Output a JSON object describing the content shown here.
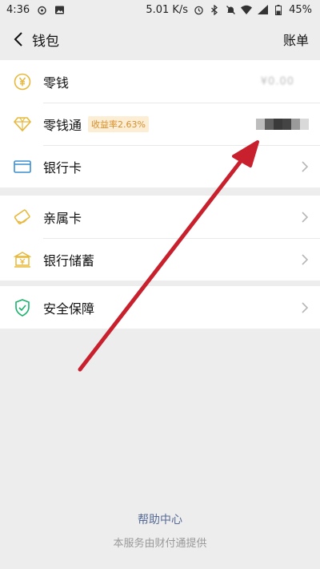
{
  "status_bar": {
    "time": "4:36",
    "network_speed": "5.01 K/s",
    "battery": "45%",
    "icons": [
      "weibo-icon",
      "gallery-icon",
      "alarm-icon",
      "bluetooth-icon",
      "mute-icon",
      "wifi-icon",
      "signal-icon",
      "battery-icon"
    ]
  },
  "nav": {
    "title": "钱包",
    "right_label": "账单"
  },
  "groups": [
    {
      "items": [
        {
          "label": "零钱",
          "icon": "yuan-coin-icon",
          "value_hidden": "¥0.00"
        },
        {
          "label": "零钱通",
          "icon": "diamond-icon",
          "badge": "收益率2.63%"
        },
        {
          "label": "银行卡",
          "icon": "bank-card-icon"
        }
      ]
    },
    {
      "items": [
        {
          "label": "亲属卡",
          "icon": "family-card-icon"
        },
        {
          "label": "银行储蓄",
          "icon": "bank-savings-icon"
        }
      ]
    },
    {
      "items": [
        {
          "label": "安全保障",
          "icon": "shield-icon"
        }
      ]
    }
  ],
  "footer": {
    "help_link": "帮助中心",
    "provider_text": "本服务由财付通提供"
  },
  "colors": {
    "accent_link": "#576b95",
    "icon_gold": "#e7b83c",
    "icon_blue": "#3a8fd1",
    "icon_green": "#18b36a",
    "annotation_arrow": "#c8202d"
  }
}
